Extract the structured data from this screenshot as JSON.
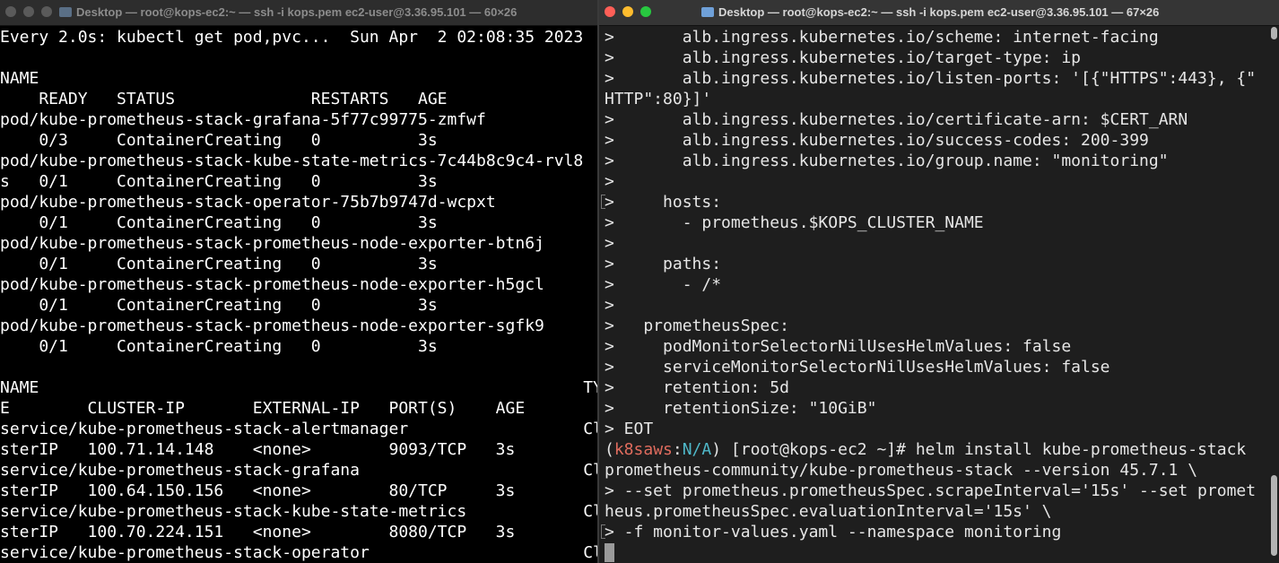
{
  "left_window": {
    "title": "Desktop — root@kops-ec2:~ — ssh -i kops.pem ec2-user@3.36.95.101 — 60×26",
    "lines": [
      "Every 2.0s: kubectl get pod,pvc...  Sun Apr  2 02:08:35 2023",
      "",
      "NAME",
      "    READY   STATUS              RESTARTS   AGE",
      "pod/kube-prometheus-stack-grafana-5f77c99775-zmfwf",
      "    0/3     ContainerCreating   0          3s",
      "pod/kube-prometheus-stack-kube-state-metrics-7c44b8c9c4-rvl8",
      "s   0/1     ContainerCreating   0          3s",
      "pod/kube-prometheus-stack-operator-75b7b9747d-wcpxt",
      "    0/1     ContainerCreating   0          3s",
      "pod/kube-prometheus-stack-prometheus-node-exporter-btn6j",
      "    0/1     ContainerCreating   0          3s",
      "pod/kube-prometheus-stack-prometheus-node-exporter-h5gcl",
      "    0/1     ContainerCreating   0          3s",
      "pod/kube-prometheus-stack-prometheus-node-exporter-sgfk9",
      "    0/1     ContainerCreating   0          3s",
      "",
      "NAME                                                        TYP",
      "E        CLUSTER-IP       EXTERNAL-IP   PORT(S)    AGE",
      "service/kube-prometheus-stack-alertmanager                  Clu",
      "sterIP   100.71.14.148    <none>        9093/TCP   3s",
      "service/kube-prometheus-stack-grafana                       Clu",
      "sterIP   100.64.150.156   <none>        80/TCP     3s",
      "service/kube-prometheus-stack-kube-state-metrics            Clu",
      "sterIP   100.70.224.151   <none>        8080/TCP   3s",
      "service/kube-prometheus-stack-operator                      Clu"
    ]
  },
  "right_window": {
    "title": "Desktop — root@kops-ec2:~ — ssh -i kops.pem ec2-user@3.36.95.101 — 67×26",
    "lines": [
      ">       alb.ingress.kubernetes.io/scheme: internet-facing",
      ">       alb.ingress.kubernetes.io/target-type: ip",
      ">       alb.ingress.kubernetes.io/listen-ports: '[{\"HTTPS\":443}, {\"",
      "HTTP\":80}]'",
      ">       alb.ingress.kubernetes.io/certificate-arn: $CERT_ARN",
      ">       alb.ingress.kubernetes.io/success-codes: 200-399",
      ">       alb.ingress.kubernetes.io/group.name: \"monitoring\"",
      ">",
      ">     hosts:",
      ">       - prometheus.$KOPS_CLUSTER_NAME",
      ">",
      ">     paths:",
      ">       - /*",
      ">",
      ">   prometheusSpec:",
      ">     podMonitorSelectorNilUsesHelmValues: false",
      ">     serviceMonitorSelectorNilUsesHelmValues: false",
      ">     retention: 5d",
      ">     retentionSize: \"10GiB\"",
      "> EOT"
    ],
    "prompt": {
      "open": "(",
      "context": "k8saws",
      "sep": ":",
      "namespace": "N/A",
      "close": ")",
      "rest": " [root@kops-ec2 ~]# helm install kube-prometheus-stack"
    },
    "lines_after": [
      "prometheus-community/kube-prometheus-stack --version 45.7.1 \\",
      "> --set prometheus.prometheusSpec.scrapeInterval='15s' --set promet",
      "heus.prometheusSpec.evaluationInterval='15s' \\",
      "> -f monitor-values.yaml --namespace monitoring"
    ]
  }
}
